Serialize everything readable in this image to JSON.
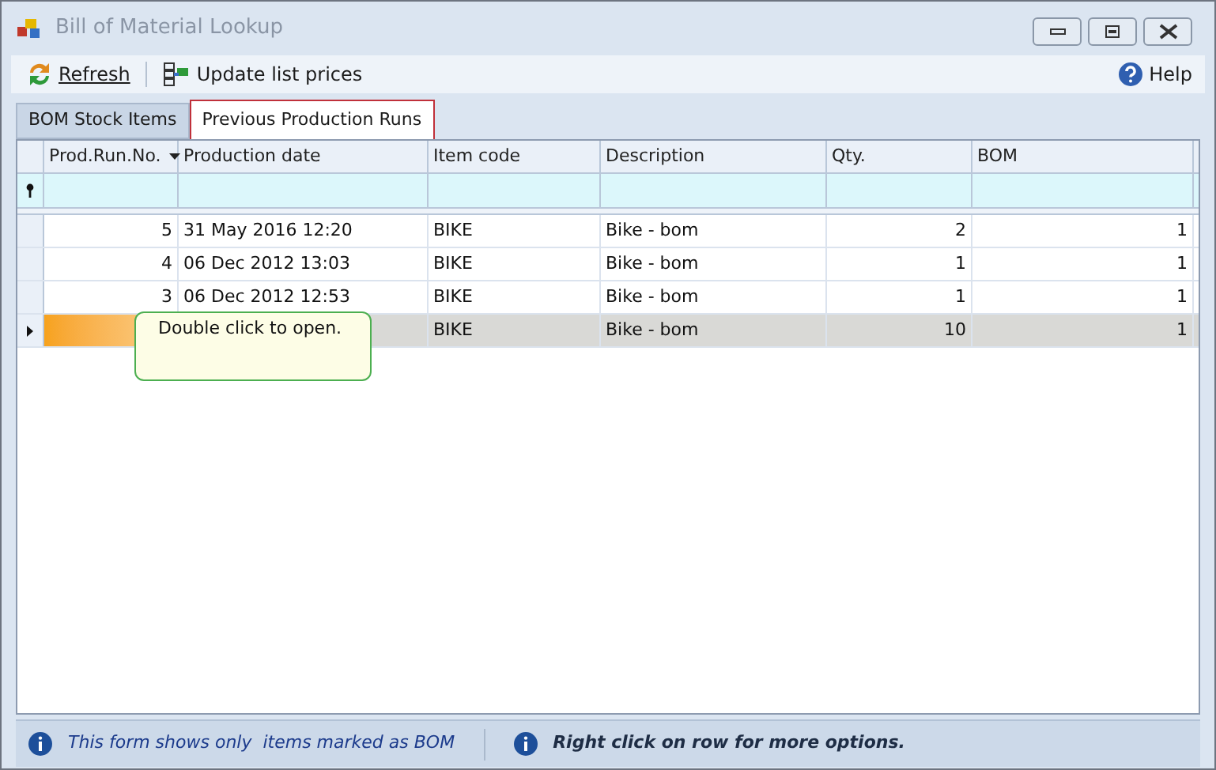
{
  "window": {
    "title": "Bill of Material Lookup"
  },
  "toolbar": [
    {
      "kind": "refresh",
      "label": "Refresh"
    },
    {
      "kind": "update",
      "label": "Update list prices"
    }
  ],
  "help": {
    "label": "Help"
  },
  "tabs": [
    {
      "label": "BOM Stock Items",
      "selected": false
    },
    {
      "label": "Previous Production Runs",
      "selected": true
    }
  ],
  "table": {
    "columns": [
      "Prod.Run.No.",
      "Production date",
      "Item code",
      "Description",
      "Qty.",
      "BOM"
    ],
    "rows": [
      {
        "cells": [
          "5",
          "31 May 2016 12:20",
          "BIKE",
          "Bike - bom",
          "2",
          "1"
        ],
        "selected": false
      },
      {
        "cells": [
          "4",
          "06 Dec 2012 13:03",
          "BIKE",
          "Bike - bom",
          "1",
          "1"
        ],
        "selected": false
      },
      {
        "cells": [
          "3",
          "06 Dec 2012 12:53",
          "BIKE",
          "Bike - bom",
          "1",
          "1"
        ],
        "selected": false
      },
      {
        "cells": [
          null,
          null,
          "BIKE",
          "Bike - bom",
          "10",
          "1"
        ],
        "selected": true
      }
    ]
  },
  "tooltip": "Double click to open.",
  "status_bar": [
    {
      "text": "This form shows only  items marked as BOM",
      "bold": false
    },
    {
      "text": "Right click on row for more options.",
      "bold": true
    }
  ]
}
